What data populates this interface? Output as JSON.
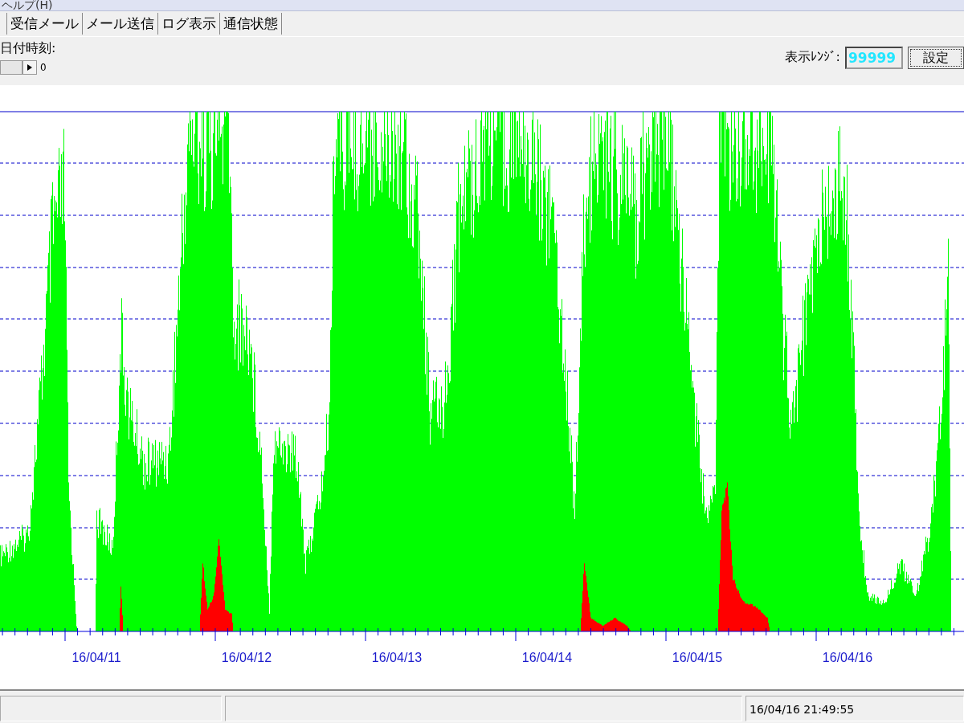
{
  "menu": [
    "ヘルプ(H)"
  ],
  "tabs": [
    {
      "label": "受信メール",
      "selected": false
    },
    {
      "label": "メール送信",
      "selected": false
    },
    {
      "label": "ログ表示",
      "selected": false
    },
    {
      "label": "通信状態",
      "selected": false
    }
  ],
  "datetime_label": "日付時刻:",
  "scroll_value": "0",
  "range": {
    "label": "表示ﾚﾝｼﾞ:",
    "value": "99999",
    "button": "設定"
  },
  "chart": {
    "x_labels": [
      "16/04/11",
      "16/04/12",
      "16/04/13",
      "16/04/14",
      "16/04/15",
      "16/04/16"
    ]
  },
  "status_bar": {
    "time": "16/04/16 21:49:55"
  }
}
